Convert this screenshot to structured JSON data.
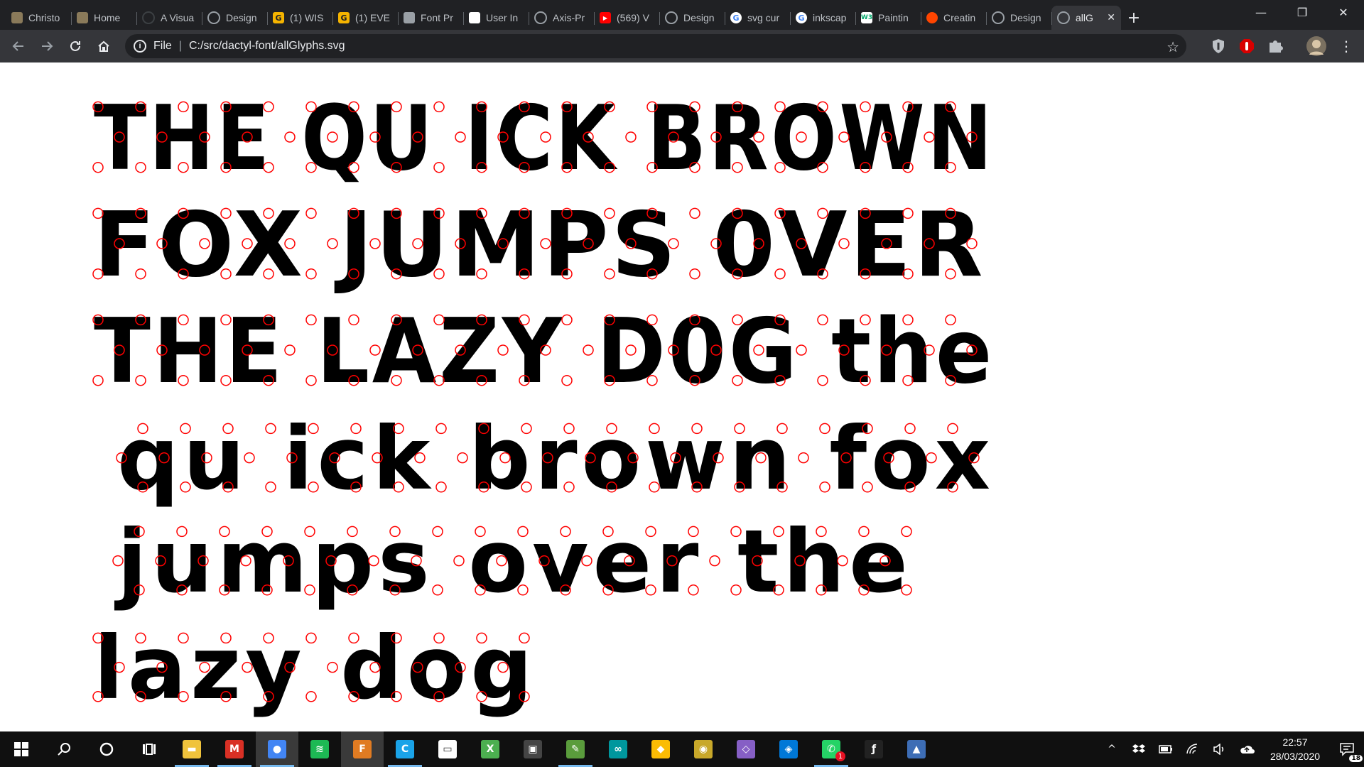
{
  "browser": {
    "tabs": [
      {
        "title": "Christo",
        "icon": "image-favicon",
        "color": "#8a7a5a"
      },
      {
        "title": "Home",
        "icon": "image-favicon",
        "color": "#8a7a5a"
      },
      {
        "title": "A Visua",
        "icon": "circle-favicon",
        "color": "#3c4043"
      },
      {
        "title": "Design",
        "icon": "globe-favicon",
        "color": "#9aa0a6"
      },
      {
        "title": "(1) WIS",
        "icon": "g-favicon",
        "color": "#f5b400"
      },
      {
        "title": "(1) EVE",
        "icon": "g-favicon",
        "color": "#f5b400"
      },
      {
        "title": "Font Pr",
        "icon": "sliders-favicon",
        "color": "#9aa0a6"
      },
      {
        "title": "User In",
        "icon": "doc-favicon",
        "color": "#ffffff"
      },
      {
        "title": "Axis-Pr",
        "icon": "globe-favicon",
        "color": "#9aa0a6"
      },
      {
        "title": "(569) V",
        "icon": "youtube-favicon",
        "color": "#ff0000"
      },
      {
        "title": "Design",
        "icon": "globe-favicon",
        "color": "#9aa0a6"
      },
      {
        "title": "svg cur",
        "icon": "google-favicon",
        "color": "#ffffff"
      },
      {
        "title": "inkscap",
        "icon": "google-favicon",
        "color": "#ffffff"
      },
      {
        "title": "Paintin",
        "icon": "w3-favicon",
        "color": "#ffffff"
      },
      {
        "title": "Creatin",
        "icon": "reddit-favicon",
        "color": "#ff4500"
      },
      {
        "title": "Design",
        "icon": "globe-favicon",
        "color": "#9aa0a6"
      },
      {
        "title": "allG",
        "icon": "globe-favicon",
        "color": "#9aa0a6",
        "active": true
      }
    ],
    "new_tab_label": "+",
    "window_controls": {
      "minimize": "—",
      "restore": "❐",
      "close": "✕"
    },
    "nav": {
      "back": "←",
      "forward": "→",
      "reload": "⟳",
      "home": "⌂"
    },
    "address": {
      "info": "i",
      "scheme": "File",
      "separator": "|",
      "url": "C:/src/dactyl-font/allGlyphs.svg",
      "bookmark": "☆"
    },
    "extensions": [
      "shield-extension",
      "stop-extension",
      "puzzle-extension",
      "profile-avatar"
    ],
    "menu": "⋮"
  },
  "document": {
    "lines": [
      "THE QU ICK BROWN",
      "FOX JUMPS 0VER",
      "THE LAZY D0G the",
      "qu ick brown fox",
      "jumps over the",
      "lazy dog"
    ],
    "glyph_fill": "#000000",
    "control_point_color": "#ff0000"
  },
  "taskbar": {
    "start": "⊞",
    "search": "⚲",
    "cortana": "○",
    "task_view": "▯",
    "apps": [
      {
        "name": "file-explorer",
        "label": "▬",
        "color": "#f0c33c",
        "running": true
      },
      {
        "name": "gmail",
        "label": "M",
        "color": "#d93025",
        "running": true
      },
      {
        "name": "chrome",
        "label": "●",
        "color": "#4285f4",
        "running": true,
        "active": true
      },
      {
        "name": "spotify",
        "label": "≋",
        "color": "#1db954",
        "running": false
      },
      {
        "name": "fusion",
        "label": "F",
        "color": "#e07b22",
        "running": false,
        "active": true
      },
      {
        "name": "cura",
        "label": "C",
        "color": "#1aa3e8",
        "running": true
      },
      {
        "name": "notepad",
        "label": "▭",
        "color": "#ffffff",
        "running": false
      },
      {
        "name": "xmind",
        "label": "X",
        "color": "#4caf50",
        "running": false
      },
      {
        "name": "terminal",
        "label": "▣",
        "color": "#444444",
        "running": false
      },
      {
        "name": "paint",
        "label": "✎",
        "color": "#5a9c3c",
        "running": true
      },
      {
        "name": "arduino",
        "label": "∞",
        "color": "#00979d",
        "running": false
      },
      {
        "name": "keep",
        "label": "◆",
        "color": "#fbbc04",
        "running": false
      },
      {
        "name": "globe-app",
        "label": "◉",
        "color": "#c8a82a",
        "running": false
      },
      {
        "name": "visual-studio",
        "label": "◇",
        "color": "#865fc5",
        "running": false
      },
      {
        "name": "vscode",
        "label": "◈",
        "color": "#0078d7",
        "running": false
      },
      {
        "name": "whatsapp",
        "label": "✆",
        "color": "#25d366",
        "running": true,
        "badge": "1"
      },
      {
        "name": "fontforge",
        "label": "ƒ",
        "color": "#222222",
        "running": false
      },
      {
        "name": "inkscape",
        "label": "▲",
        "color": "#3d6db5",
        "running": false
      }
    ],
    "tray": {
      "chevron": "^",
      "icons": [
        "dropbox-icon",
        "battery-icon",
        "wifi-icon",
        "volume-icon",
        "onedrive-icon"
      ],
      "time": "22:57",
      "date": "28/03/2020",
      "notifications": "18"
    }
  }
}
